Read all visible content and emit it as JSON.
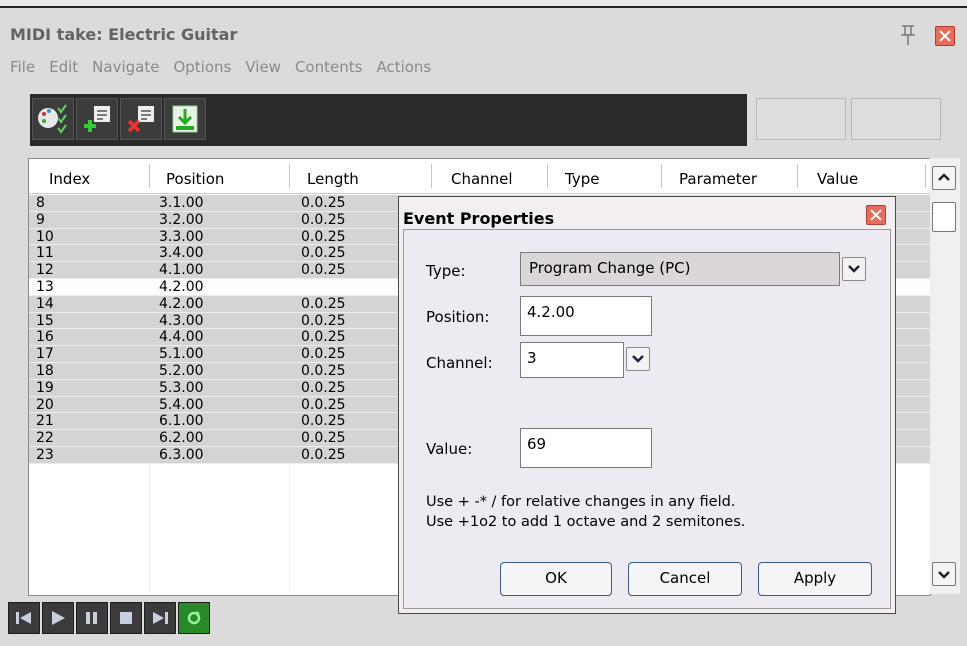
{
  "window": {
    "title": "MIDI take: Electric Guitar"
  },
  "menu": [
    "File",
    "Edit",
    "Navigate",
    "Options",
    "View",
    "Contents",
    "Actions"
  ],
  "toolbar": {
    "icons": [
      "event-properties-icon",
      "insert-event-icon",
      "delete-event-icon",
      "insert-at-cursor-icon"
    ]
  },
  "list": {
    "columns": [
      "Index",
      "Position",
      "Length",
      "Channel",
      "Type",
      "Parameter",
      "Value"
    ],
    "rows": [
      {
        "index": "8",
        "position": "3.1.00",
        "length": "0.0.25"
      },
      {
        "index": "9",
        "position": "3.2.00",
        "length": "0.0.25"
      },
      {
        "index": "10",
        "position": "3.3.00",
        "length": "0.0.25"
      },
      {
        "index": "11",
        "position": "3.4.00",
        "length": "0.0.25"
      },
      {
        "index": "12",
        "position": "4.1.00",
        "length": "0.0.25"
      },
      {
        "index": "13",
        "position": "4.2.00",
        "length": ""
      },
      {
        "index": "14",
        "position": "4.2.00",
        "length": "0.0.25"
      },
      {
        "index": "15",
        "position": "4.3.00",
        "length": "0.0.25"
      },
      {
        "index": "16",
        "position": "4.4.00",
        "length": "0.0.25"
      },
      {
        "index": "17",
        "position": "5.1.00",
        "length": "0.0.25"
      },
      {
        "index": "18",
        "position": "5.2.00",
        "length": "0.0.25"
      },
      {
        "index": "19",
        "position": "5.3.00",
        "length": "0.0.25"
      },
      {
        "index": "20",
        "position": "5.4.00",
        "length": "0.0.25"
      },
      {
        "index": "21",
        "position": "6.1.00",
        "length": "0.0.25"
      },
      {
        "index": "22",
        "position": "6.2.00",
        "length": "0.0.25"
      },
      {
        "index": "23",
        "position": "6.3.00",
        "length": "0.0.25"
      }
    ],
    "selected_index": "13"
  },
  "dialog": {
    "title": "Event Properties",
    "type_label": "Type:",
    "type_value": "Program Change (PC)",
    "position_label": "Position:",
    "position_value": "4.2.00",
    "channel_label": "Channel:",
    "channel_value": "3",
    "value_label": "Value:",
    "value_value": "69",
    "hint1": "Use + -* / for relative changes in any field.",
    "hint2": "Use +1o2  to add 1 octave and 2 semitones.",
    "ok": "OK",
    "cancel": "Cancel",
    "apply": "Apply"
  },
  "transport": [
    "go-to-start-icon",
    "play-icon",
    "pause-icon",
    "stop-icon",
    "go-to-end-icon",
    "repeat-icon"
  ],
  "colors": {
    "toolbar_bg": "#2a2a2a",
    "close_red": "#e86b5b",
    "repeat_active": "#2a8a2a"
  }
}
